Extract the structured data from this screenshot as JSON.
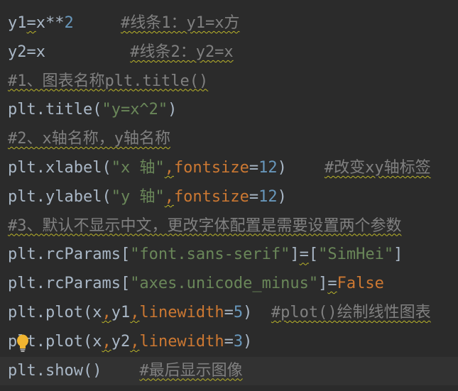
{
  "editor": {
    "lines": [
      {
        "tokens": [
          {
            "text": "y1",
            "cls": "t-plain"
          },
          {
            "text": "=",
            "cls": "t-plain wavy"
          },
          {
            "text": "x**",
            "cls": "t-plain"
          },
          {
            "text": "2",
            "cls": "t-number"
          },
          {
            "text": "     ",
            "cls": "t-plain"
          },
          {
            "text": "#线条1：y1=x方",
            "cls": "t-comment wavy"
          }
        ]
      },
      {
        "tokens": [
          {
            "text": "y2=x",
            "cls": "t-plain"
          },
          {
            "text": "         ",
            "cls": "t-plain"
          },
          {
            "text": "#线条2：y2=x",
            "cls": "t-comment wavy"
          }
        ]
      },
      {
        "tokens": [
          {
            "text": "#1、图表名称plt.title()",
            "cls": "t-comment wavy"
          }
        ]
      },
      {
        "tokens": [
          {
            "text": "plt.title(",
            "cls": "t-plain"
          },
          {
            "text": "\"y=x^2\"",
            "cls": "t-string"
          },
          {
            "text": ")",
            "cls": "t-plain"
          }
        ]
      },
      {
        "tokens": [
          {
            "text": "#2、x轴名称，y轴名称",
            "cls": "t-comment wavy"
          }
        ]
      },
      {
        "tokens": [
          {
            "text": "plt.xlabel(",
            "cls": "t-plain"
          },
          {
            "text": "\"x 轴\"",
            "cls": "t-string"
          },
          {
            "text": ",",
            "cls": "t-kw wavy"
          },
          {
            "text": "fontsize",
            "cls": "t-param"
          },
          {
            "text": "=",
            "cls": "t-plain"
          },
          {
            "text": "12",
            "cls": "t-number"
          },
          {
            "text": ")    ",
            "cls": "t-plain"
          },
          {
            "text": "#改变xy轴标签",
            "cls": "t-comment wavy"
          }
        ]
      },
      {
        "tokens": [
          {
            "text": "plt.ylabel(",
            "cls": "t-plain"
          },
          {
            "text": "\"y 轴\"",
            "cls": "t-string"
          },
          {
            "text": ",",
            "cls": "t-kw wavy"
          },
          {
            "text": "fontsize",
            "cls": "t-param"
          },
          {
            "text": "=",
            "cls": "t-plain"
          },
          {
            "text": "12",
            "cls": "t-number"
          },
          {
            "text": ")",
            "cls": "t-plain"
          }
        ]
      },
      {
        "tokens": [
          {
            "text": "#3、默认不显示中文，更改字体配置是需要设置两个参数",
            "cls": "t-comment wavy"
          }
        ]
      },
      {
        "tokens": [
          {
            "text": "plt.rcParams[",
            "cls": "t-plain"
          },
          {
            "text": "\"font.sans-serif\"",
            "cls": "t-string"
          },
          {
            "text": "]",
            "cls": "t-plain"
          },
          {
            "text": "=",
            "cls": "t-plain wavy"
          },
          {
            "text": "[",
            "cls": "t-plain"
          },
          {
            "text": "\"SimHei\"",
            "cls": "t-string"
          },
          {
            "text": "]",
            "cls": "t-plain"
          }
        ]
      },
      {
        "tokens": [
          {
            "text": "plt.rcParams[",
            "cls": "t-plain"
          },
          {
            "text": "\"axes.unicode_minus\"",
            "cls": "t-string"
          },
          {
            "text": "]",
            "cls": "t-plain"
          },
          {
            "text": "=",
            "cls": "t-plain wavy"
          },
          {
            "text": "False",
            "cls": "t-kw"
          }
        ]
      },
      {
        "tokens": [
          {
            "text": "plt.plot(x",
            "cls": "t-plain"
          },
          {
            "text": ",",
            "cls": "t-kw wavy"
          },
          {
            "text": "y1",
            "cls": "t-plain"
          },
          {
            "text": ",",
            "cls": "t-kw wavy"
          },
          {
            "text": "linewidth",
            "cls": "t-param"
          },
          {
            "text": "=",
            "cls": "t-plain"
          },
          {
            "text": "5",
            "cls": "t-number"
          },
          {
            "text": ")  ",
            "cls": "t-plain"
          },
          {
            "text": "#plot()绘制线性图表",
            "cls": "t-comment wavy"
          }
        ]
      },
      {
        "tokens": [
          {
            "text": "plt.plot(x",
            "cls": "t-plain"
          },
          {
            "text": ",",
            "cls": "t-kw wavy"
          },
          {
            "text": "y2",
            "cls": "t-plain"
          },
          {
            "text": ",",
            "cls": "t-kw wavy"
          },
          {
            "text": "linewidth",
            "cls": "t-param"
          },
          {
            "text": "=",
            "cls": "t-plain"
          },
          {
            "text": "3",
            "cls": "t-number"
          },
          {
            "text": ")",
            "cls": "t-plain"
          }
        ]
      },
      {
        "current": true,
        "tokens": [
          {
            "text": "plt.show()",
            "cls": "t-plain"
          },
          {
            "text": "    ",
            "cls": "t-plain"
          },
          {
            "text": "#最后显示图像",
            "cls": "t-comment wavy"
          }
        ]
      }
    ],
    "gutter_icon": "lightbulb-icon",
    "colors": {
      "background": "#2b2b2b",
      "current_line": "#323232",
      "plain": "#a9b7c6",
      "comment": "#808080",
      "string": "#6a8759",
      "number": "#6897bb",
      "keyword": "#cc7832",
      "lightbulb": "#f0b430"
    }
  }
}
